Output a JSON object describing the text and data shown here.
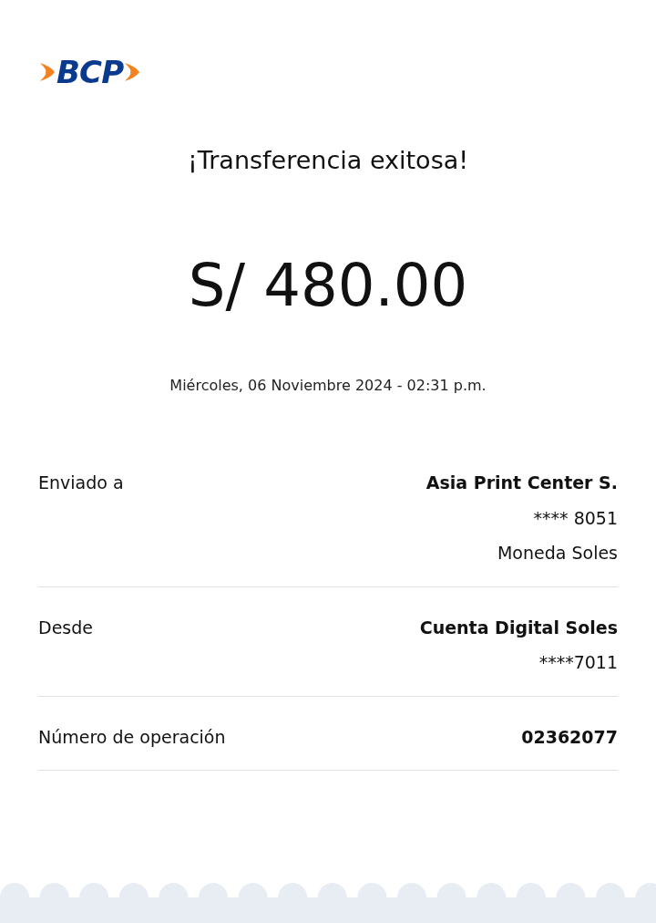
{
  "logo": {
    "text": "BCP"
  },
  "title": "¡Transferencia exitosa!",
  "amount": "S/ 480.00",
  "date": "Miércoles, 06 Noviembre 2024 - 02:31 p.m.",
  "details": [
    {
      "label": "Enviado a",
      "values": [
        {
          "text": "Asia Print Center S.",
          "bold": true
        },
        {
          "text": "**** 8051",
          "bold": false
        },
        {
          "text": "Moneda Soles",
          "bold": false
        }
      ]
    },
    {
      "label": "Desde",
      "values": [
        {
          "text": "Cuenta Digital Soles",
          "bold": true
        },
        {
          "text": "****7011",
          "bold": false
        }
      ]
    },
    {
      "label": "Número de operación",
      "values": [
        {
          "text": "02362077",
          "bold": true
        }
      ]
    }
  ]
}
